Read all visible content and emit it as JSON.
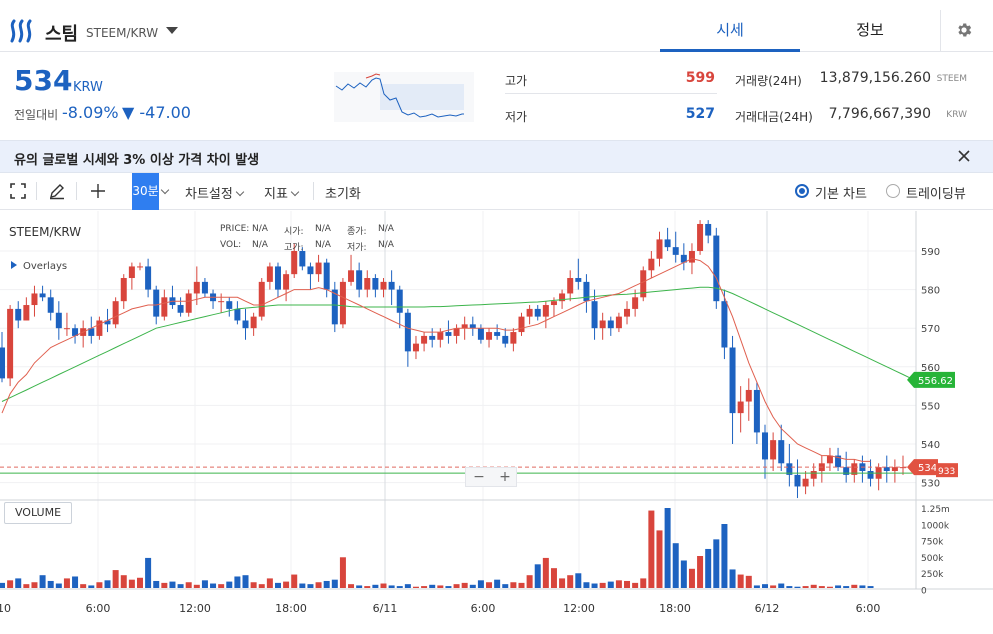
{
  "header": {
    "coin_name": "스팀",
    "pair": "STEEM/KRW",
    "tabs": [
      "시세",
      "정보"
    ]
  },
  "ticker": {
    "price": "534",
    "unit": "KRW",
    "change_label": "전일대비",
    "change_rate": "-8.09%",
    "change_value": "▼ -47.00",
    "high_label": "고가",
    "high_value": "599",
    "low_label": "저가",
    "low_value": "527",
    "volume_label": "거래량(24H)",
    "volume_value": "13,879,156.260",
    "volume_unit": "STEEM",
    "amount_label": "거래대금(24H)",
    "amount_value": "7,796,667,390",
    "amount_unit": "KRW"
  },
  "notice": {
    "title": "유의   글로벌 시세와 3% 이상 가격 차이 발생"
  },
  "toolbar": {
    "interval": "30분",
    "chart_settings": "차트설정",
    "indicators": "지표",
    "reset": "초기화",
    "basic_chart": "기본 차트",
    "tradingview": "트레이딩뷰"
  },
  "chart_overlay": {
    "pair": "STEEM/KRW",
    "overlays": "Overlays",
    "price_label": "PRICE:",
    "price_value": "N/A",
    "open_label": "시가:",
    "open_value": "N/A",
    "close_label": "종가:",
    "close_value": "N/A",
    "vol_label": "VOL:",
    "vol_value": "N/A",
    "high_label": "고가:",
    "high_value": "N/A",
    "low_label": "저가:",
    "low_value": "N/A",
    "volume_panel": "VOLUME",
    "zoom_out": "−",
    "zoom_in": "+"
  },
  "chart_data": {
    "type": "candlestick",
    "interval": "30m",
    "price_ticks": [
      590,
      580,
      570,
      560,
      550,
      540,
      530
    ],
    "volume_ticks": [
      "1.25m",
      "1000k",
      "750k",
      "500k",
      "250k",
      "0"
    ],
    "x_ticks": [
      "10",
      "6:00",
      "12:00",
      "18:00",
      "6/11",
      "6:00",
      "12:00",
      "18:00",
      "6/12",
      "6:00"
    ],
    "last_price_tag": "534",
    "ma_tag": "556.62",
    "ma_tag_color": "#27b438",
    "last_tag_color": "#e15241",
    "countdown_tag": "933",
    "up_color": "#d8453c",
    "down_color": "#1d62c0",
    "ohlc": [
      [
        565,
        569,
        556,
        557
      ],
      [
        557,
        576,
        555,
        575
      ],
      [
        575,
        577,
        570,
        572
      ],
      [
        572,
        578,
        572,
        576
      ],
      [
        576,
        581,
        573,
        579
      ],
      [
        579,
        581,
        577,
        578
      ],
      [
        578,
        580,
        572,
        574
      ],
      [
        574,
        577,
        567,
        570
      ],
      [
        570,
        574,
        568,
        570
      ],
      [
        570,
        571,
        566,
        568
      ],
      [
        568,
        572,
        565,
        570
      ],
      [
        570,
        573,
        566,
        568
      ],
      [
        568,
        573,
        567,
        572
      ],
      [
        572,
        575,
        569,
        571
      ],
      [
        571,
        578,
        570,
        577
      ],
      [
        577,
        584,
        575,
        583
      ],
      [
        583,
        587,
        580,
        586
      ],
      [
        586,
        587,
        585,
        586
      ],
      [
        586,
        588,
        578,
        580
      ],
      [
        580,
        581,
        571,
        573
      ],
      [
        573,
        580,
        572,
        578
      ],
      [
        578,
        581,
        575,
        576
      ],
      [
        576,
        578,
        573,
        574
      ],
      [
        574,
        580,
        573,
        579
      ],
      [
        579,
        586,
        576,
        582
      ],
      [
        582,
        583,
        578,
        579
      ],
      [
        579,
        580,
        575,
        577
      ],
      [
        577,
        579,
        574,
        577
      ],
      [
        577,
        578,
        573,
        575
      ],
      [
        575,
        577,
        571,
        572
      ],
      [
        572,
        575,
        567,
        570
      ],
      [
        570,
        574,
        568,
        573
      ],
      [
        573,
        583,
        572,
        582
      ],
      [
        582,
        587,
        580,
        586
      ],
      [
        586,
        587,
        578,
        580
      ],
      [
        580,
        585,
        577,
        584
      ],
      [
        584,
        592,
        583,
        590
      ],
      [
        590,
        591,
        585,
        586
      ],
      [
        586,
        587,
        580,
        584
      ],
      [
        584,
        589,
        582,
        587
      ],
      [
        587,
        588,
        578,
        580
      ],
      [
        580,
        582,
        569,
        571
      ],
      [
        571,
        583,
        570,
        582
      ],
      [
        582,
        589,
        581,
        585
      ],
      [
        585,
        587,
        578,
        580
      ],
      [
        580,
        585,
        578,
        583
      ],
      [
        583,
        584,
        578,
        580
      ],
      [
        580,
        583,
        578,
        582
      ],
      [
        582,
        585,
        576,
        580
      ],
      [
        580,
        581,
        570,
        574
      ],
      [
        574,
        575,
        560,
        564
      ],
      [
        564,
        568,
        562,
        566
      ],
      [
        566,
        569,
        564,
        568
      ],
      [
        568,
        570,
        565,
        567
      ],
      [
        567,
        570,
        565,
        569
      ],
      [
        569,
        572,
        566,
        568
      ],
      [
        568,
        571,
        566,
        570
      ],
      [
        570,
        573,
        567,
        571
      ],
      [
        571,
        573,
        568,
        570
      ],
      [
        570,
        571,
        566,
        567
      ],
      [
        567,
        570,
        565,
        569
      ],
      [
        569,
        571,
        567,
        568
      ],
      [
        568,
        570,
        565,
        566
      ],
      [
        566,
        570,
        564,
        569
      ],
      [
        569,
        574,
        568,
        573
      ],
      [
        573,
        576,
        571,
        575
      ],
      [
        575,
        576,
        572,
        573
      ],
      [
        573,
        577,
        570,
        576
      ],
      [
        576,
        578,
        573,
        577
      ],
      [
        577,
        580,
        575,
        579
      ],
      [
        579,
        585,
        577,
        583
      ],
      [
        583,
        588,
        580,
        582
      ],
      [
        582,
        584,
        574,
        577
      ],
      [
        577,
        580,
        567,
        570
      ],
      [
        570,
        574,
        567,
        572
      ],
      [
        572,
        573,
        568,
        570
      ],
      [
        570,
        574,
        569,
        573
      ],
      [
        573,
        577,
        571,
        575
      ],
      [
        575,
        580,
        573,
        578
      ],
      [
        578,
        586,
        577,
        585
      ],
      [
        585,
        590,
        583,
        588
      ],
      [
        588,
        595,
        586,
        593
      ],
      [
        593,
        596,
        590,
        591
      ],
      [
        591,
        595,
        587,
        589
      ],
      [
        589,
        592,
        585,
        587
      ],
      [
        587,
        592,
        584,
        590
      ],
      [
        590,
        598,
        589,
        597
      ],
      [
        597,
        598,
        592,
        594
      ],
      [
        594,
        596,
        575,
        577
      ],
      [
        577,
        580,
        562,
        565
      ],
      [
        565,
        568,
        540,
        548
      ],
      [
        548,
        555,
        543,
        551
      ],
      [
        551,
        557,
        546,
        554
      ],
      [
        554,
        556,
        540,
        543
      ],
      [
        543,
        545,
        531,
        536
      ],
      [
        536,
        543,
        533,
        541
      ],
      [
        541,
        545,
        533,
        535
      ],
      [
        535,
        540,
        529,
        532
      ],
      [
        532,
        536,
        526,
        529
      ],
      [
        529,
        533,
        527,
        531
      ],
      [
        531,
        535,
        529,
        533
      ],
      [
        533,
        537,
        530,
        535
      ],
      [
        535,
        539,
        533,
        537
      ],
      [
        537,
        539,
        533,
        534
      ],
      [
        534,
        538,
        530,
        532
      ],
      [
        532,
        536,
        530,
        535
      ],
      [
        535,
        537,
        530,
        533
      ],
      [
        533,
        536,
        529,
        531
      ],
      [
        531,
        535,
        528,
        534
      ],
      [
        534,
        537,
        530,
        533
      ],
      [
        533,
        536,
        530,
        534
      ],
      [
        534,
        537,
        532,
        534
      ]
    ],
    "volume": [
      80,
      120,
      150,
      60,
      90,
      200,
      110,
      70,
      150,
      180,
      60,
      40,
      90,
      120,
      280,
      200,
      130,
      160,
      470,
      110,
      80,
      100,
      60,
      90,
      50,
      120,
      70,
      60,
      100,
      180,
      200,
      90,
      60,
      150,
      80,
      100,
      210,
      70,
      60,
      90,
      110,
      130,
      480,
      60,
      40,
      30,
      50,
      70,
      40,
      30,
      60,
      20,
      30,
      50,
      40,
      30,
      60,
      80,
      50,
      120,
      90,
      130,
      60,
      90,
      80,
      200,
      370,
      470,
      310,
      150,
      200,
      230,
      90,
      70,
      80,
      100,
      120,
      110,
      80,
      150,
      1210,
      900,
      1280,
      700,
      430,
      300,
      500,
      610,
      760,
      1000,
      290,
      210,
      190,
      40,
      60,
      40,
      70,
      30,
      20,
      30,
      50,
      30,
      20,
      40,
      30,
      50,
      40,
      30
    ],
    "ma_fast": [
      548,
      553,
      556,
      558,
      561,
      563,
      565,
      566,
      567,
      568,
      569,
      570,
      571,
      572,
      573,
      574,
      575,
      575.5,
      576,
      576,
      576.5,
      577,
      577,
      577,
      577.5,
      578,
      578,
      578,
      578,
      578,
      577,
      576,
      576,
      577,
      578,
      579,
      580,
      580,
      580,
      580.5,
      580,
      579,
      578,
      577,
      576,
      575,
      574,
      573,
      572,
      571,
      570,
      569.5,
      569,
      569,
      569,
      569.5,
      570,
      570,
      570,
      570,
      570,
      570,
      569.5,
      569.5,
      570,
      570.5,
      571,
      572,
      573,
      574,
      575,
      576,
      577,
      577.5,
      578,
      578.5,
      579,
      580,
      581,
      582,
      583,
      584,
      585,
      586,
      587,
      588,
      587.5,
      586,
      583,
      578,
      573,
      567,
      561,
      556,
      551,
      547,
      544,
      542,
      540,
      539,
      538,
      537,
      537,
      536.5,
      536,
      536,
      535.5,
      535.5
    ],
    "ma_slow": [
      551,
      552,
      553,
      554,
      555,
      556,
      557,
      558,
      559,
      560,
      561,
      562,
      563,
      564,
      565,
      566,
      567,
      568,
      569,
      570,
      570.5,
      571,
      571.5,
      572,
      572.5,
      573,
      573.5,
      574,
      574.5,
      575,
      575.2,
      575.4,
      575.6,
      575.8,
      576,
      576,
      576,
      576,
      576,
      576,
      576,
      576,
      575.8,
      575.6,
      575.5,
      575.5,
      575.5,
      575.5,
      575.5,
      575.5,
      575.5,
      575.5,
      575.5,
      575.6,
      575.6,
      575.7,
      575.8,
      575.9,
      576,
      576.1,
      576.2,
      576.3,
      576.4,
      576.5,
      576.6,
      576.7,
      576.8,
      577,
      577.2,
      577.4,
      577.6,
      577.8,
      578,
      578.2,
      578.4,
      578.6,
      578.7,
      578.8,
      579,
      579.2,
      579.4,
      579.6,
      579.8,
      580,
      580.2,
      580.4,
      580.6,
      580.6,
      580.4,
      579.8,
      579,
      578,
      577,
      576,
      575,
      574,
      573,
      572,
      571,
      570,
      569,
      568,
      567,
      566,
      565,
      564,
      563,
      562,
      561,
      560,
      559,
      558,
      557,
      556.6
    ]
  }
}
